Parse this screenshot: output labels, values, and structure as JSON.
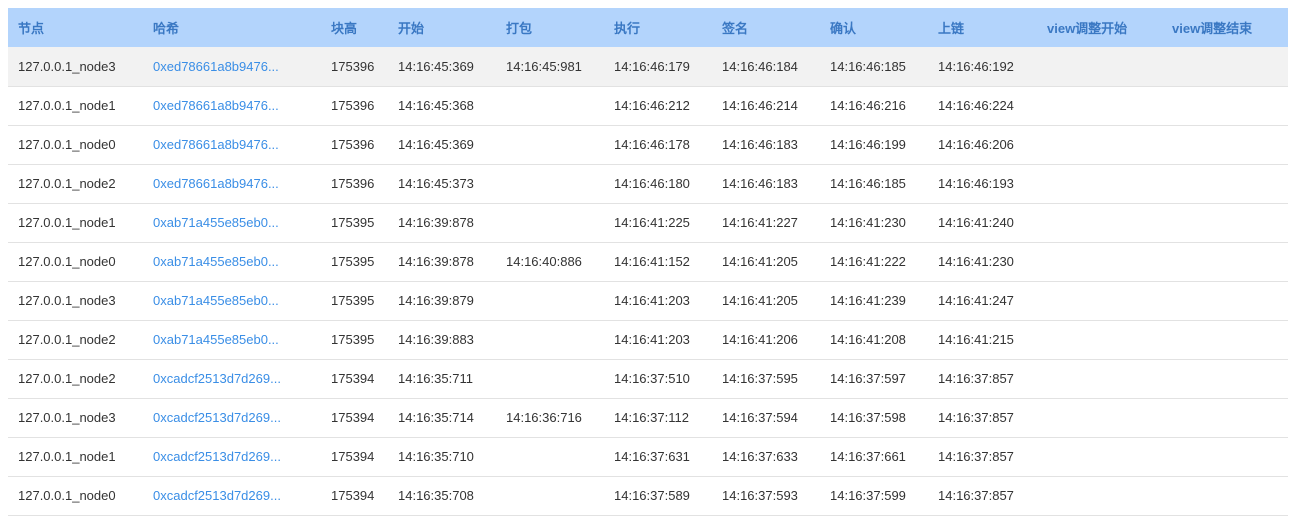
{
  "columns": [
    "节点",
    "哈希",
    "块高",
    "开始",
    "打包",
    "执行",
    "签名",
    "确认",
    "上链",
    "view调整开始",
    "view调整结束"
  ],
  "rows": [
    [
      "127.0.0.1_node3",
      "0xed78661a8b9476...",
      "175396",
      "14:16:45:369",
      "14:16:45:981",
      "14:16:46:179",
      "14:16:46:184",
      "14:16:46:185",
      "14:16:46:192",
      "",
      ""
    ],
    [
      "127.0.0.1_node1",
      "0xed78661a8b9476...",
      "175396",
      "14:16:45:368",
      "",
      "14:16:46:212",
      "14:16:46:214",
      "14:16:46:216",
      "14:16:46:224",
      "",
      ""
    ],
    [
      "127.0.0.1_node0",
      "0xed78661a8b9476...",
      "175396",
      "14:16:45:369",
      "",
      "14:16:46:178",
      "14:16:46:183",
      "14:16:46:199",
      "14:16:46:206",
      "",
      ""
    ],
    [
      "127.0.0.1_node2",
      "0xed78661a8b9476...",
      "175396",
      "14:16:45:373",
      "",
      "14:16:46:180",
      "14:16:46:183",
      "14:16:46:185",
      "14:16:46:193",
      "",
      ""
    ],
    [
      "127.0.0.1_node1",
      "0xab71a455e85eb0...",
      "175395",
      "14:16:39:878",
      "",
      "14:16:41:225",
      "14:16:41:227",
      "14:16:41:230",
      "14:16:41:240",
      "",
      ""
    ],
    [
      "127.0.0.1_node0",
      "0xab71a455e85eb0...",
      "175395",
      "14:16:39:878",
      "14:16:40:886",
      "14:16:41:152",
      "14:16:41:205",
      "14:16:41:222",
      "14:16:41:230",
      "",
      ""
    ],
    [
      "127.0.0.1_node3",
      "0xab71a455e85eb0...",
      "175395",
      "14:16:39:879",
      "",
      "14:16:41:203",
      "14:16:41:205",
      "14:16:41:239",
      "14:16:41:247",
      "",
      ""
    ],
    [
      "127.0.0.1_node2",
      "0xab71a455e85eb0...",
      "175395",
      "14:16:39:883",
      "",
      "14:16:41:203",
      "14:16:41:206",
      "14:16:41:208",
      "14:16:41:215",
      "",
      ""
    ],
    [
      "127.0.0.1_node2",
      "0xcadcf2513d7d269...",
      "175394",
      "14:16:35:711",
      "",
      "14:16:37:510",
      "14:16:37:595",
      "14:16:37:597",
      "14:16:37:857",
      "",
      ""
    ],
    [
      "127.0.0.1_node3",
      "0xcadcf2513d7d269...",
      "175394",
      "14:16:35:714",
      "14:16:36:716",
      "14:16:37:112",
      "14:16:37:594",
      "14:16:37:598",
      "14:16:37:857",
      "",
      ""
    ],
    [
      "127.0.0.1_node1",
      "0xcadcf2513d7d269...",
      "175394",
      "14:16:35:710",
      "",
      "14:16:37:631",
      "14:16:37:633",
      "14:16:37:661",
      "14:16:37:857",
      "",
      ""
    ],
    [
      "127.0.0.1_node0",
      "0xcadcf2513d7d269...",
      "175394",
      "14:16:35:708",
      "",
      "14:16:37:589",
      "14:16:37:593",
      "14:16:37:599",
      "14:16:37:857",
      "",
      ""
    ]
  ],
  "highlighted_row": 0,
  "colors": {
    "header_bg": "#b3d4fc",
    "header_text": "#3a78c3",
    "link": "#3a8ee6",
    "row_highlight": "#f2f2f2"
  }
}
